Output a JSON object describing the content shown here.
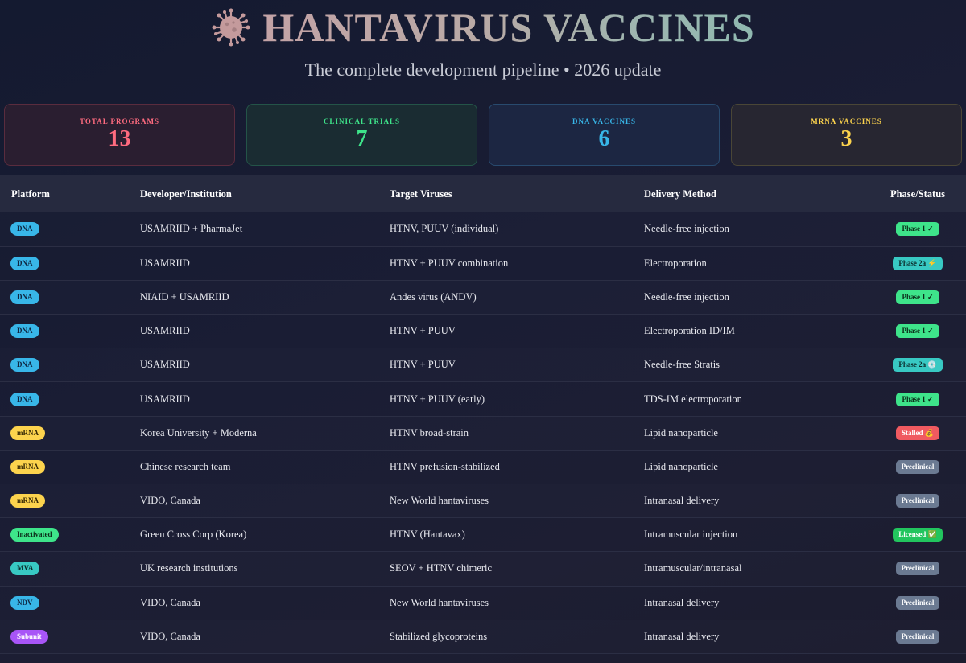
{
  "header": {
    "title": "HANTAVIRUS VACCINES",
    "subtitle": "The complete development pipeline • 2026 update",
    "icon": "virus-icon"
  },
  "stats": [
    {
      "label": "TOTAL PROGRAMS",
      "value": "13",
      "color": "#ff6b7f"
    },
    {
      "label": "CLINICAL TRIALS",
      "value": "7",
      "color": "#3ee48a"
    },
    {
      "label": "DNA VACCINES",
      "value": "6",
      "color": "#38b6e8"
    },
    {
      "label": "MRNA VACCINES",
      "value": "3",
      "color": "#fcd34d"
    }
  ],
  "table": {
    "columns": [
      "Platform",
      "Developer/Institution",
      "Target Viruses",
      "Delivery Method",
      "Phase/Status"
    ],
    "rows": [
      {
        "platform": "DNA",
        "developer": "USAMRIID + PharmaJet",
        "target": "HTNV, PUUV (individual)",
        "delivery": "Needle-free injection",
        "status": "Phase 1 ✓"
      },
      {
        "platform": "DNA",
        "developer": "USAMRIID",
        "target": "HTNV + PUUV combination",
        "delivery": "Electroporation",
        "status": "Phase 2a ⚡"
      },
      {
        "platform": "DNA",
        "developer": "NIAID + USAMRIID",
        "target": "Andes virus (ANDV)",
        "delivery": "Needle-free injection",
        "status": "Phase 1 ✓"
      },
      {
        "platform": "DNA",
        "developer": "USAMRIID",
        "target": "HTNV + PUUV",
        "delivery": "Electroporation ID/IM",
        "status": "Phase 1 ✓"
      },
      {
        "platform": "DNA",
        "developer": "USAMRIID",
        "target": "HTNV + PUUV",
        "delivery": "Needle-free Stratis",
        "status": "Phase 2a 💿"
      },
      {
        "platform": "DNA",
        "developer": "USAMRIID",
        "target": "HTNV + PUUV (early)",
        "delivery": "TDS-IM electroporation",
        "status": "Phase 1 ✓"
      },
      {
        "platform": "mRNA",
        "developer": "Korea University + Moderna",
        "target": "HTNV broad-strain",
        "delivery": "Lipid nanoparticle",
        "status": "Stalled 💰"
      },
      {
        "platform": "mRNA",
        "developer": "Chinese research team",
        "target": "HTNV prefusion-stabilized",
        "delivery": "Lipid nanoparticle",
        "status": "Preclinical"
      },
      {
        "platform": "mRNA",
        "developer": "VIDO, Canada",
        "target": "New World hantaviruses",
        "delivery": "Intranasal delivery",
        "status": "Preclinical"
      },
      {
        "platform": "Inactivated",
        "developer": "Green Cross Corp (Korea)",
        "target": "HTNV (Hantavax)",
        "delivery": "Intramuscular injection",
        "status": "Licensed ✅"
      },
      {
        "platform": "MVA",
        "developer": "UK research institutions",
        "target": "SEOV + HTNV chimeric",
        "delivery": "Intramuscular/intranasal",
        "status": "Preclinical"
      },
      {
        "platform": "NDV",
        "developer": "VIDO, Canada",
        "target": "New World hantaviruses",
        "delivery": "Intranasal delivery",
        "status": "Preclinical"
      },
      {
        "platform": "Subunit",
        "developer": "VIDO, Canada",
        "target": "Stabilized glycoproteins",
        "delivery": "Intranasal delivery",
        "status": "Preclinical"
      }
    ]
  },
  "colors": {
    "dna": "#38b6e8",
    "mrna": "#fcd34d",
    "inactivated": "#3ee48a",
    "mva": "#38c9c3",
    "subunit": "#a855f7",
    "phase1": "#3ee48a",
    "phase2a": "#38c9c3",
    "stalled": "#f05a60",
    "preclinical": "#6b7a92",
    "licensed": "#22c55e"
  }
}
